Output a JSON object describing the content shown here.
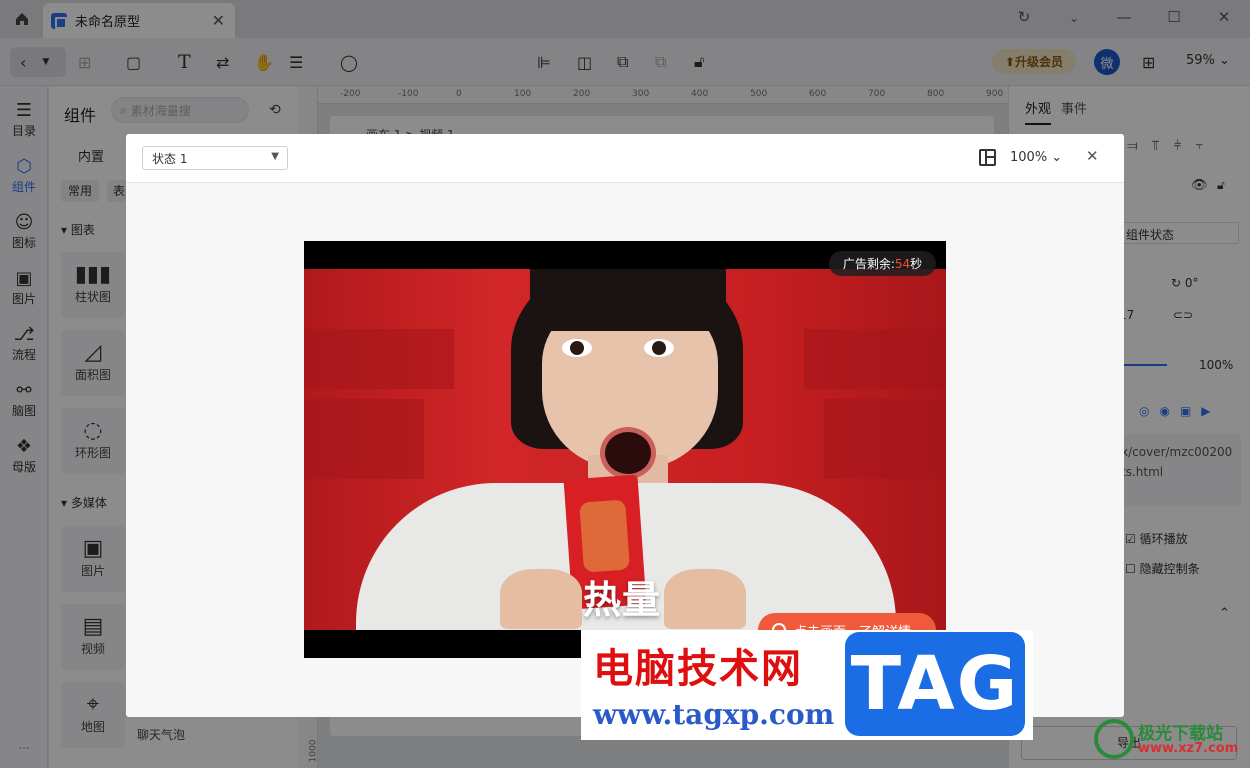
{
  "titlebar": {
    "tab_title": "未命名原型"
  },
  "toolbar": {
    "vip_label": "升级会员",
    "avatar_text": "微",
    "zoom": "59%"
  },
  "rail": {
    "items": [
      {
        "label": "目录",
        "icon": "list-icon"
      },
      {
        "label": "组件",
        "icon": "component-icon"
      },
      {
        "label": "图标",
        "icon": "smile-icon"
      },
      {
        "label": "图片",
        "icon": "image-icon"
      },
      {
        "label": "流程",
        "icon": "flow-icon"
      },
      {
        "label": "脑图",
        "icon": "mindmap-icon"
      },
      {
        "label": "母版",
        "icon": "master-icon"
      }
    ],
    "more": "..."
  },
  "panel": {
    "title": "组件",
    "search_placeholder": "素材海量搜",
    "tab_builtin": "内置",
    "chip_common": "常用",
    "chip_table": "表",
    "section_charts": "图表",
    "section_media": "多媒体",
    "cards": {
      "bar": "柱状图",
      "area": "面积图",
      "ring": "环形图",
      "picture": "图片",
      "video": "视频",
      "map": "地图",
      "bubble": "聊天气泡"
    }
  },
  "canvas": {
    "ruler_ticks": [
      "-200",
      "-100",
      "0",
      "100",
      "200",
      "300",
      "400",
      "500",
      "600",
      "700",
      "800",
      "900"
    ],
    "ruler_v_tick": "1000",
    "frame_label_1": "画布 1",
    "frame_label_2": "视频 1"
  },
  "right_panel": {
    "tab_appearance": "外观",
    "tab_events": "事件",
    "component_state": "组件状态",
    "rotation": "0°",
    "size_value": "17",
    "opacity": "100%",
    "url_line1": "x/cover/mzc00200",
    "url_line2": "ts.html",
    "loop_play": "循环播放",
    "hide_controls": "隐藏控制条",
    "export": "导出"
  },
  "modal": {
    "state_value": "状态 1",
    "zoom": "100%",
    "ad_prefix": "广告剩余: ",
    "ad_seconds": "54",
    "ad_suffix": "秒",
    "overlay_text": "热量",
    "cta": "点击画面，了解详情"
  },
  "watermark": {
    "title": "电脑技术网",
    "url": "www.tagxp.com",
    "tag": "TAG",
    "site2_title": "极光下载站",
    "site2_url": "www.xz7.com"
  },
  "colors": {
    "accent": "#2f6ff5",
    "vip_bg": "#f5e6c7",
    "cta": "#f05a3b"
  }
}
